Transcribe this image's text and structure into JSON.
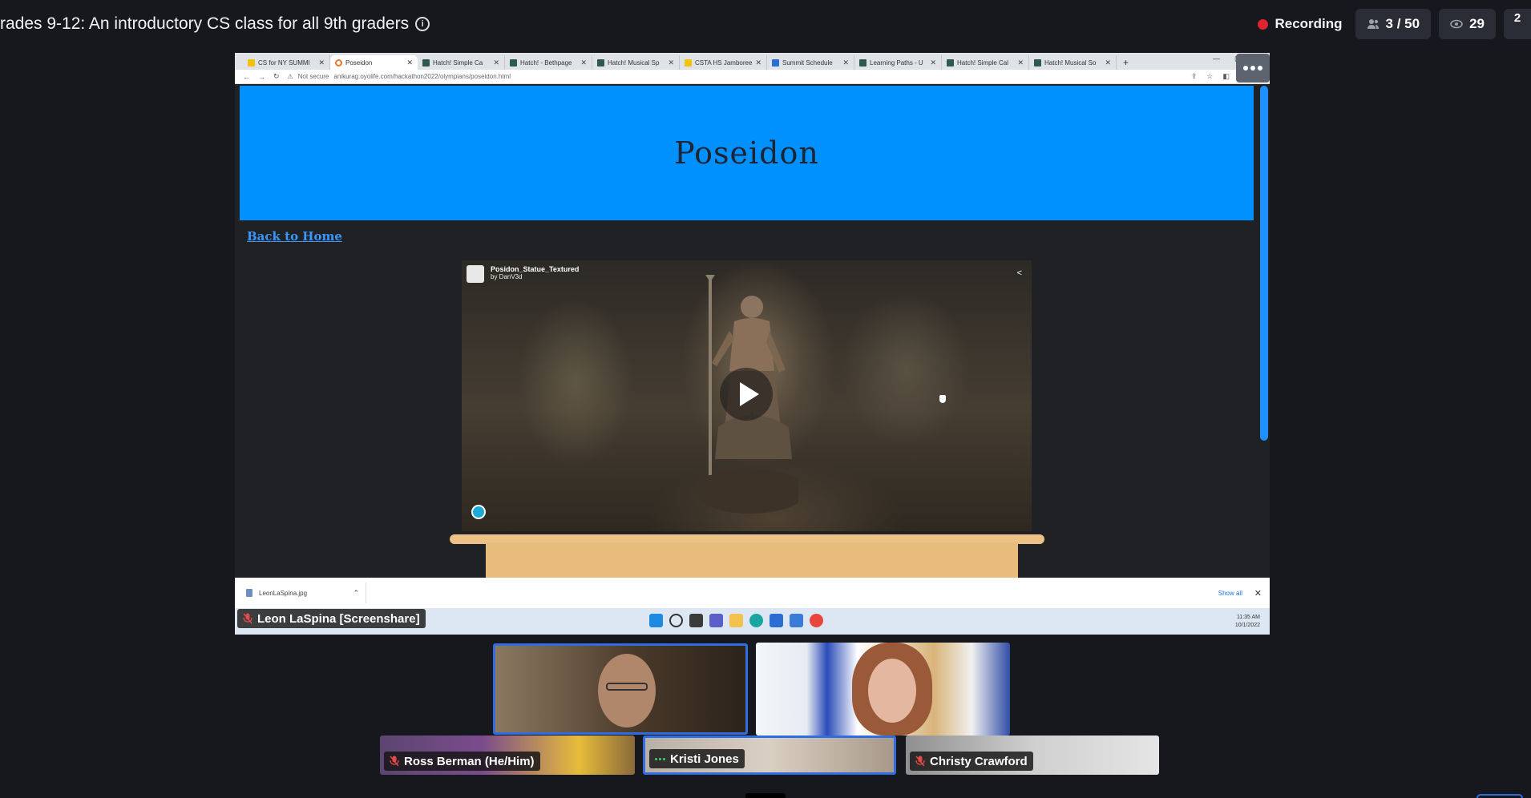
{
  "meeting": {
    "title": "rades 9-12: An introductory CS class for all 9th graders",
    "recording_label": "Recording",
    "participants_count": "3 / 50",
    "viewers_count": "29",
    "corner_badge": "2",
    "rec_color": "#e0242f"
  },
  "browser": {
    "tabs": [
      {
        "label": "CS for NY SUMMI",
        "icon": "yellow",
        "active": false
      },
      {
        "label": "Poseidon",
        "icon": "orange",
        "active": true
      },
      {
        "label": "Hatch! Simple Ca",
        "icon": "green",
        "active": false
      },
      {
        "label": "Hatch! - Bethpage",
        "icon": "green",
        "active": false
      },
      {
        "label": "Hatch! Musical Sp",
        "icon": "green",
        "active": false
      },
      {
        "label": "CSTA HS Jamboree",
        "icon": "yellow",
        "active": false
      },
      {
        "label": "Summit Schedule",
        "icon": "blue",
        "active": false
      },
      {
        "label": "Learning Paths - U",
        "icon": "green",
        "active": false
      },
      {
        "label": "Hatch! Simple Cal",
        "icon": "green",
        "active": false
      },
      {
        "label": "Hatch! Musical So",
        "icon": "green",
        "active": false
      }
    ],
    "security": "Not secure",
    "url": "anikurag.oyolife.com/hackathon2022/olympians/poseidon.html"
  },
  "webpage": {
    "banner_title": "Poseidon",
    "banner_color": "#0091ff",
    "back_link": "Back to Home",
    "model": {
      "name": "Posidon_Statue_Textured",
      "author": "by DanV3d"
    }
  },
  "downloads": {
    "file": "LeonLaSpina.jpg",
    "show_all": "Show all"
  },
  "taskbar": {
    "time": "11:35 AM",
    "date": "10/1/2022"
  },
  "share_label": "Leon LaSpina [Screenshare]",
  "participants": [
    {
      "name": "Ross Berman (He/Him)",
      "muted": true
    },
    {
      "name": "Kristi Jones",
      "muted": false
    },
    {
      "name": "Christy Crawford",
      "muted": true
    }
  ]
}
